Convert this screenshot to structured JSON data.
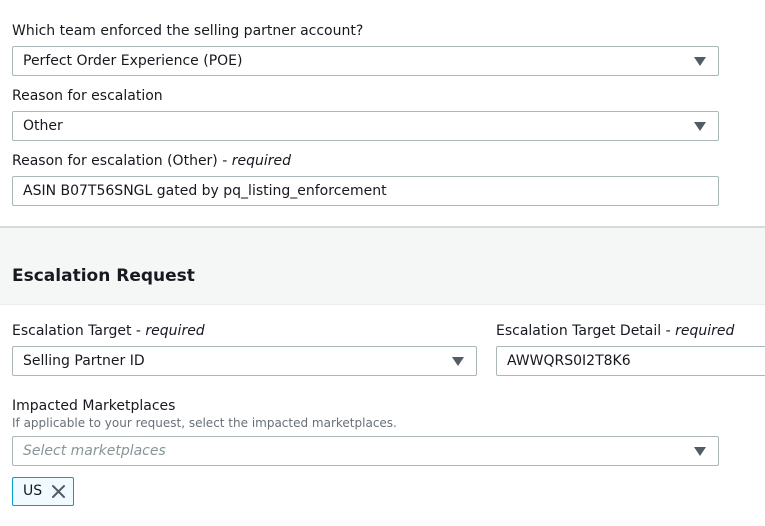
{
  "enforcing_team": {
    "label": "Which team enforced the selling partner account?",
    "value": "Perfect Order Experience (POE)"
  },
  "escalation_reason": {
    "label": "Reason for escalation",
    "value": "Other"
  },
  "escalation_reason_other": {
    "label": "Reason for escalation (Other)",
    "required_text": "required",
    "value": "ASIN B07T56SNGL gated by pq_listing_enforcement"
  },
  "escalation_request": {
    "title": "Escalation Request",
    "target": {
      "label": "Escalation Target",
      "required_text": "required",
      "value": "Selling Partner ID"
    },
    "target_detail": {
      "label": "Escalation Target Detail",
      "required_text": "required",
      "value": "AWWQRS0I2T8K6"
    },
    "marketplaces": {
      "label": "Impacted Marketplaces",
      "help": "If applicable to your request, select the impacted marketplaces.",
      "placeholder": "Select marketplaces",
      "selected": [
        "US"
      ]
    }
  },
  "separator": " - ",
  "icons": {
    "dropdown": "caret-down-icon",
    "remove": "close-icon"
  },
  "colors": {
    "border": "#aab7b8",
    "token_border": "#00a1c9",
    "token_bg": "#f1faff",
    "section_bg": "#f5f6f6",
    "text": "#16191f",
    "help_text": "#687078",
    "placeholder": "#879596"
  }
}
